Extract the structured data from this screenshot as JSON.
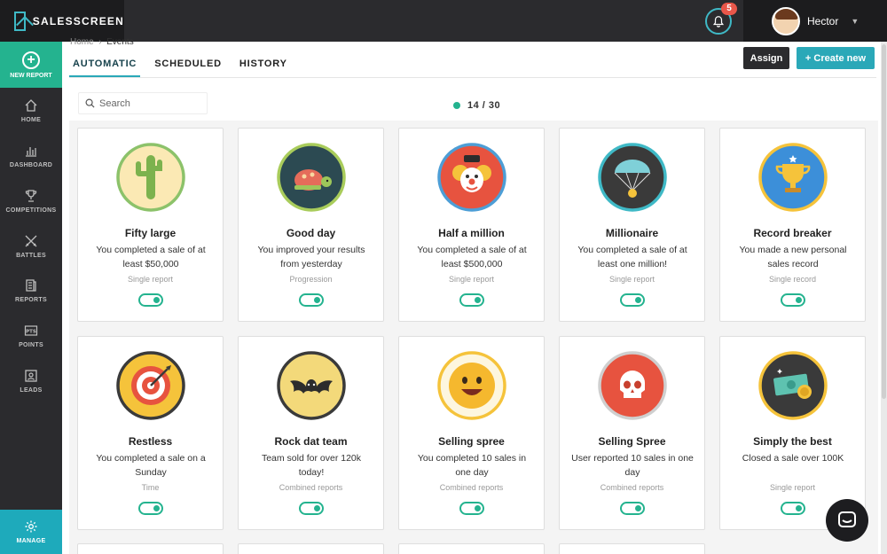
{
  "app": {
    "brand": "SALESSCREEN",
    "notifications": "5",
    "user": "Hector"
  },
  "sidebar": {
    "new_report": "NEW REPORT",
    "items": [
      {
        "label": "HOME",
        "icon": "home-icon"
      },
      {
        "label": "DASHBOARD",
        "icon": "bar-chart-icon"
      },
      {
        "label": "COMPETITIONS",
        "icon": "trophy-icon"
      },
      {
        "label": "BATTLES",
        "icon": "crossed-swords-icon"
      },
      {
        "label": "REPORTS",
        "icon": "report-icon"
      },
      {
        "label": "POINTS",
        "icon": "points-icon"
      },
      {
        "label": "LEADS",
        "icon": "leads-icon"
      }
    ],
    "manage": "MANAGE"
  },
  "breadcrumb": {
    "root": "Home",
    "current": "Events"
  },
  "tabs": [
    "AUTOMATIC",
    "SCHEDULED",
    "HISTORY"
  ],
  "toolbar": {
    "assign": "Assign",
    "create": "+ Create new"
  },
  "search": {
    "placeholder": "Search"
  },
  "counter": "14 / 30",
  "colors": {
    "accent": "#2aa8b8",
    "green": "#24b38f",
    "dark": "#2b2b2e"
  },
  "cards": [
    {
      "title": "Fifty large",
      "desc": "You completed a sale of at least $50,000",
      "type": "Single report",
      "icon": "cactus-icon",
      "enabled": true
    },
    {
      "title": "Good day",
      "desc": "You improved your results from yesterday",
      "type": "Progression",
      "icon": "turtle-icon",
      "enabled": true
    },
    {
      "title": "Half a million",
      "desc": "You completed a sale of at least $500,000",
      "type": "Single report",
      "icon": "clown-icon",
      "enabled": true
    },
    {
      "title": "Millionaire",
      "desc": "You completed a sale of at least one million!",
      "type": "Single report",
      "icon": "parachute-icon",
      "enabled": true
    },
    {
      "title": "Record breaker",
      "desc": "You made a new personal sales record",
      "type": "Single record",
      "icon": "trophy-icon",
      "enabled": true
    },
    {
      "title": "Restless",
      "desc": "You completed a sale on a Sunday",
      "type": "Time",
      "icon": "target-icon",
      "enabled": true
    },
    {
      "title": "Rock dat team",
      "desc": "Team sold for over 120k today!",
      "type": "Combined reports",
      "icon": "bat-icon",
      "enabled": true
    },
    {
      "title": "Selling spree",
      "desc": "You completed 10 sales in one day",
      "type": "Combined reports",
      "icon": "smiley-icon",
      "enabled": true
    },
    {
      "title": "Selling Spree",
      "desc": "User reported 10 sales in one day",
      "type": "Combined reports",
      "icon": "skull-icon",
      "enabled": true
    },
    {
      "title": "Simply the best",
      "desc": "Closed a sale over 100K",
      "type": "Single report",
      "icon": "money-icon",
      "enabled": true
    }
  ]
}
